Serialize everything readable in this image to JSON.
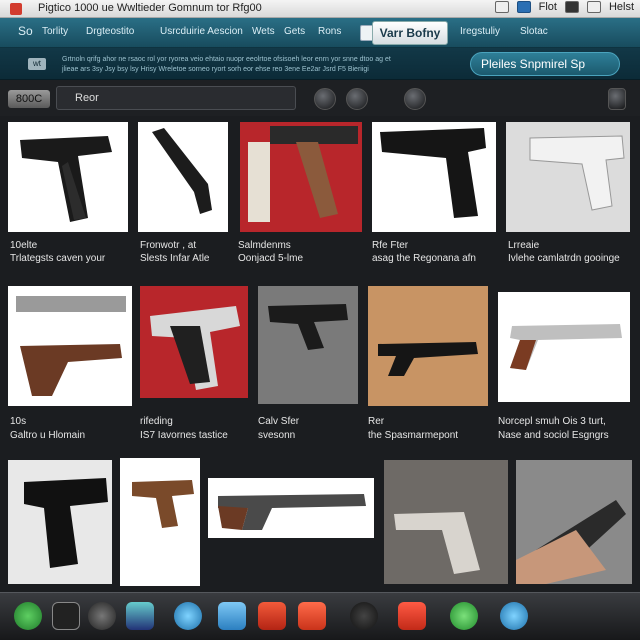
{
  "titlebar": {
    "title": "Pigtico 1000 ue Wwltieder Gomnum tor Rfg00",
    "right_text_1": "Flot",
    "right_text_2": "Helst"
  },
  "nav": {
    "items": [
      "So",
      "Torlity",
      "Drgteostito",
      "Usrcduirie Aescion",
      "Wets",
      "Gets",
      "Rons"
    ],
    "brand": "Varr Bofny",
    "right_items": [
      "Iregstuliy",
      "Slotac"
    ]
  },
  "subheader": {
    "badge": "wt",
    "line1": "Grtnoln qrifg ahor ne rsaoc rol yor ryorea veio ehtaio nuopr eeolrtoe ofsisoeh leor enrn yor snne dtoo ag et",
    "line2": "jlieae ars 3sy Jsy bsy lsy Hrisy Wreletoe sorneo ryort sorh eor ehse reo 3ene Ee2ar Jsrd F5 Bieriigi",
    "pill": "Pleiles  Snpmirel  Sp"
  },
  "search": {
    "tag": "800C",
    "value": "Reor"
  },
  "grid": {
    "row1": [
      {
        "title": "10elte",
        "sub": "Trlategsts  caven your"
      },
      {
        "title": "Fronwotr , at",
        "sub": "Slests  Infar  Atle"
      },
      {
        "title": "Salmdenms",
        "sub": "Oonjacd  5-lme"
      },
      {
        "title": "Rfe Fter",
        "sub": "asag the Regonana  afn"
      },
      {
        "title": "Lrreaie",
        "sub": "Ivlehe  camlatrdn  gooinge"
      }
    ],
    "row2": [
      {
        "title": "10s",
        "sub": "Galtro  u Hlomain"
      },
      {
        "title": "rifeding",
        "sub": "IS7 Iavornes  tastice"
      },
      {
        "title": "Calv Sfer",
        "sub": "svesonn"
      },
      {
        "title": "Rer",
        "sub": "the Spasmarmepont"
      },
      {
        "title": "Norcepl smuh Ois 3 turt,",
        "sub": "Nase  and  sociol  Esgngrs"
      }
    ]
  },
  "colors": {
    "nav": "#1f5f74",
    "accent": "#2e7f98",
    "background": "#1b1d20"
  }
}
